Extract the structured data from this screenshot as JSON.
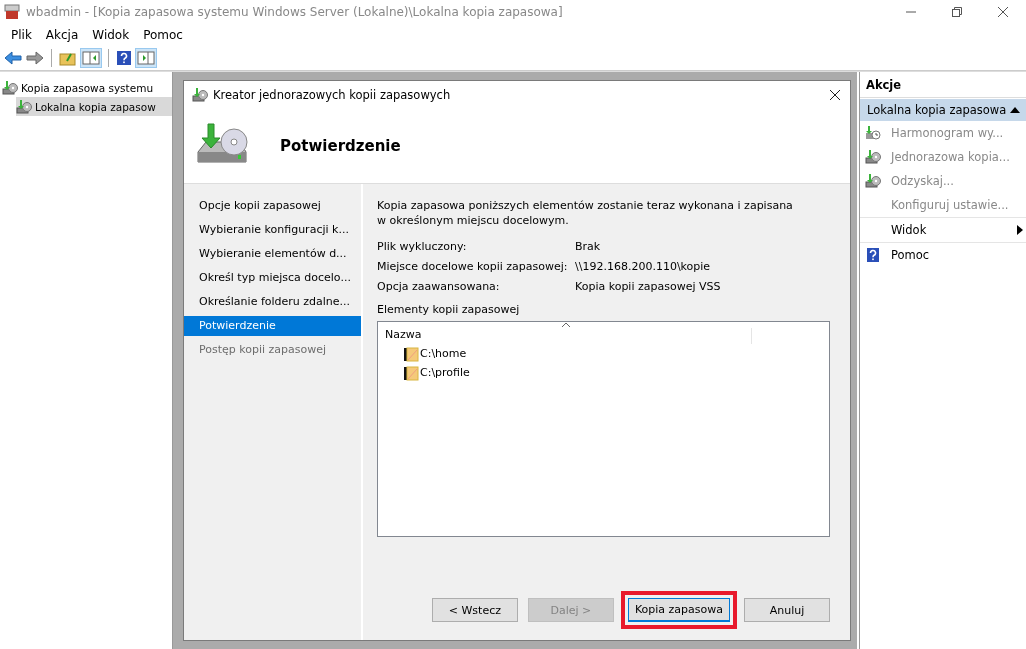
{
  "window": {
    "title": "wbadmin - [Kopia zapasowa systemu Windows Server (Lokalne)\\Lokalna kopia zapasowa]"
  },
  "menu": [
    "Plik",
    "Akcja",
    "Widok",
    "Pomoc"
  ],
  "tree": [
    {
      "label": "Kopia zapasowa systemu",
      "selected": false,
      "children": [
        {
          "label": "Lokalna kopia zapasow",
          "selected": true
        }
      ]
    }
  ],
  "dialog": {
    "title": "Kreator jednorazowych kopii zapasowych",
    "heading": "Potwierdzenie",
    "steps": [
      {
        "label": "Opcje kopii zapasowej",
        "selected": false,
        "disabled": false
      },
      {
        "label": "Wybieranie konfiguracji k...",
        "selected": false,
        "disabled": false
      },
      {
        "label": "Wybieranie elementów d...",
        "selected": false,
        "disabled": false
      },
      {
        "label": "Określ typ miejsca docelo...",
        "selected": false,
        "disabled": false
      },
      {
        "label": "Określanie folderu zdalne...",
        "selected": false,
        "disabled": false
      },
      {
        "label": "Potwierdzenie",
        "selected": true,
        "disabled": false
      },
      {
        "label": "Postęp kopii zapasowej",
        "selected": false,
        "disabled": true
      }
    ],
    "description": "Kopia zapasowa poniższych elementów zostanie teraz wykonana i zapisana w określonym miejscu docelowym.",
    "summary": [
      {
        "label": "Plik wykluczony:",
        "value": "Brak"
      },
      {
        "label": "Miejsce docelowe kopii zapasowej:",
        "value": "\\\\192.168.200.110\\kopie"
      },
      {
        "label": "Opcja zaawansowana:",
        "value": "Kopia kopii zapasowej VSS"
      }
    ],
    "items_label": "Elementy kopii zapasowej",
    "items_column": "Nazwa",
    "items": [
      "C:\\home",
      "C:\\profile"
    ],
    "buttons": [
      {
        "label": "< Wstecz",
        "disabled": false,
        "highlighted": false
      },
      {
        "label": "Dalej >",
        "disabled": true,
        "highlighted": false
      },
      {
        "label": "Kopia zapasowa",
        "disabled": false,
        "highlighted": true
      },
      {
        "label": "Anuluj",
        "disabled": false,
        "highlighted": false
      }
    ]
  },
  "actions": {
    "title": "Akcje",
    "section": {
      "label": "Lokalna kopia zapasowa",
      "expanded": true
    },
    "items": [
      {
        "label": "Harmonogram wy...",
        "disabled": true,
        "submenu": false
      },
      {
        "label": "Jednorazowa kopia...",
        "disabled": true,
        "submenu": false
      },
      {
        "label": "Odzyskaj...",
        "disabled": true,
        "submenu": false
      },
      {
        "label": "Konfiguruj ustawie...",
        "disabled": true,
        "submenu": false
      },
      {
        "label": "Widok",
        "disabled": false,
        "submenu": true
      },
      {
        "label": "Pomoc",
        "disabled": false,
        "submenu": false
      }
    ]
  }
}
